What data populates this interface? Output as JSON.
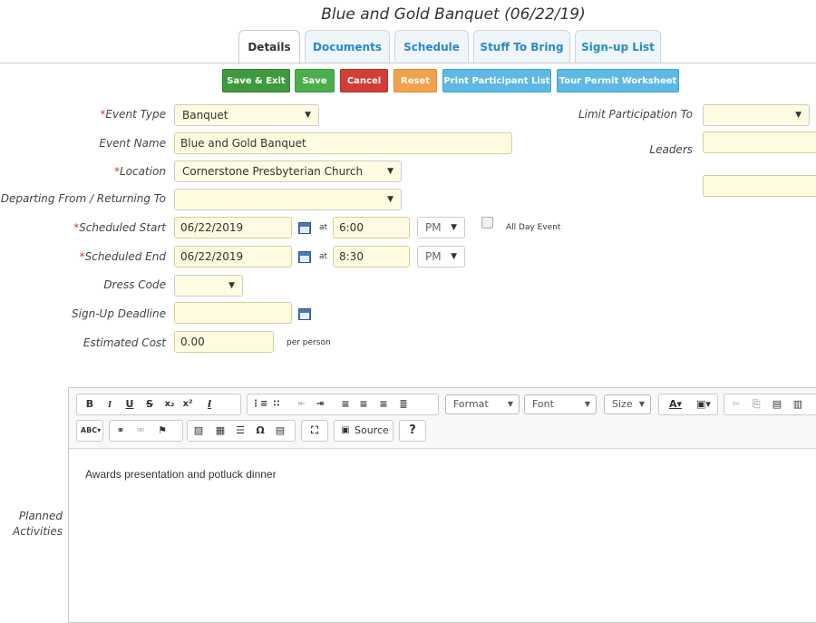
{
  "page_title": "Blue and Gold Banquet (06/22/19)",
  "tabs": [
    {
      "label": "Details",
      "active": true
    },
    {
      "label": "Documents",
      "active": false
    },
    {
      "label": "Schedule",
      "active": false
    },
    {
      "label": "Stuff To Bring",
      "active": false
    },
    {
      "label": "Sign-up List",
      "active": false
    }
  ],
  "actions": {
    "save_exit": "Save & Exit",
    "save": "Save",
    "cancel": "Cancel",
    "reset": "Reset",
    "print_list": "Print Participant List",
    "tour_permit": "Tour Permit Worksheet"
  },
  "form": {
    "event_type": {
      "label": "Event Type",
      "value": "Banquet",
      "required": "*"
    },
    "event_name": {
      "label": "Event Name",
      "value": "Blue and Gold Banquet"
    },
    "location": {
      "label": "Location",
      "value": "Cornerstone Presbyterian Church",
      "required": "*"
    },
    "departing": {
      "label": "Departing From / Returning To",
      "value": ""
    },
    "scheduled_start": {
      "label": "Scheduled Start",
      "date": "06/22/2019",
      "at": "at",
      "time": "6:00",
      "ampm": "PM",
      "required": "*"
    },
    "all_day": {
      "label": "All Day Event",
      "checked": false
    },
    "scheduled_end": {
      "label": "Scheduled End",
      "date": "06/22/2019",
      "at": "at",
      "time": "8:30",
      "ampm": "PM",
      "required": "*"
    },
    "dress_code": {
      "label": "Dress Code",
      "value": ""
    },
    "signup_deadline": {
      "label": "Sign-Up Deadline",
      "value": ""
    },
    "estimated_cost": {
      "label": "Estimated Cost",
      "value": "0.00",
      "suffix": "per person"
    },
    "limit_participation": {
      "label": "Limit Participation To",
      "value": ""
    },
    "leaders": {
      "label": "Leaders"
    }
  },
  "editor": {
    "label_line1": "Planned",
    "label_line2": "Activities",
    "format": "Format",
    "font": "Font",
    "size": "Size",
    "source": "Source",
    "help": "?",
    "content": "Awards presentation and potluck dinner"
  },
  "colors": {
    "tab_text": "#2a89c8",
    "save_exit": "#3e9a3e",
    "cancel": "#d23e36",
    "reset": "#f0a34c",
    "blue_button": "#5db9e3",
    "input_bg": "#fffbe0",
    "required": "#d9342b"
  }
}
